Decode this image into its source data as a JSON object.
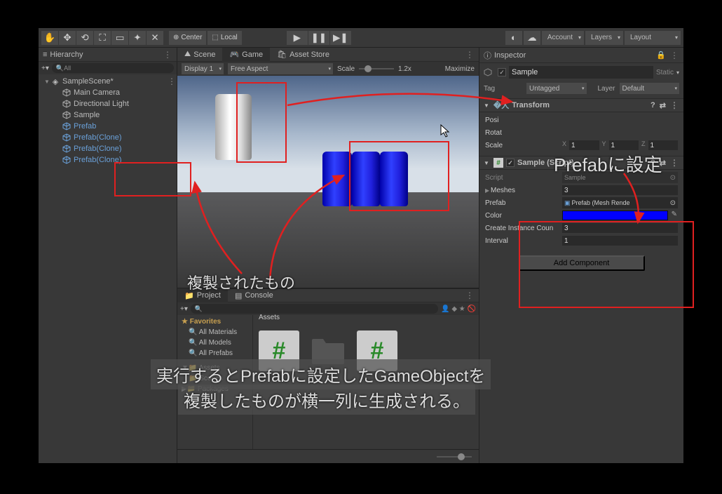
{
  "toolbar": {
    "center_label": "Center",
    "local_label": "Local",
    "account_label": "Account",
    "layers_label": "Layers",
    "layout_label": "Layout"
  },
  "hierarchy": {
    "title": "Hierarchy",
    "search_placeholder": "All",
    "scene": "SampleScene*",
    "items": [
      {
        "label": "Main Camera",
        "prefab": false
      },
      {
        "label": "Directional Light",
        "prefab": false
      },
      {
        "label": "Sample",
        "prefab": false
      },
      {
        "label": "Prefab",
        "prefab": true
      },
      {
        "label": "Prefab(Clone)",
        "prefab": true,
        "boxed": true
      },
      {
        "label": "Prefab(Clone)",
        "prefab": true,
        "boxed": true
      },
      {
        "label": "Prefab(Clone)",
        "prefab": true,
        "boxed": true
      }
    ]
  },
  "tabs": {
    "scene": "Scene",
    "game": "Game",
    "asset_store": "Asset Store"
  },
  "game_toolbar": {
    "display": "Display 1",
    "aspect": "Free Aspect",
    "scale_label": "Scale",
    "scale_value": "1.2x",
    "maximize": "Maximize"
  },
  "project": {
    "project_tab": "Project",
    "console_tab": "Console",
    "favorites": "Favorites",
    "fav_items": [
      "All Materials",
      "All Models",
      "All Prefabs"
    ],
    "assets_head": "Assets",
    "assets_items": [
      "Scenes"
    ],
    "packages": "Packages",
    "assets_breadcrumb": "Assets"
  },
  "inspector": {
    "title": "Inspector",
    "go_name": "Sample",
    "static_label": "Static",
    "tag_label": "Tag",
    "tag_value": "Untagged",
    "layer_label": "Layer",
    "layer_value": "Default",
    "transform": {
      "title": "Transform",
      "position": {
        "label": "Posi",
        "x": "",
        "y": "",
        "z": ""
      },
      "rotation": {
        "label": "Rotat",
        "x": "",
        "y": "",
        "z": ""
      },
      "scale": {
        "label": "Scale",
        "x": "1",
        "y": "1",
        "z": "1"
      }
    },
    "script": {
      "title": "Sample (Script)",
      "script_label": "Script",
      "script_value": "Sample",
      "meshes_label": "Meshes",
      "meshes_value": "3",
      "prefab_label": "Prefab",
      "prefab_value": "Prefab (Mesh Rende",
      "color_label": "Color",
      "count_label": "Create Instance Coun",
      "count_value": "3",
      "interval_label": "Interval",
      "interval_value": "1"
    },
    "add_component": "Add Component"
  },
  "annotations": {
    "cloned": "複製されたもの",
    "prefab_set": "Prefabに設定",
    "runtime1": "実行するとPrefabに設定したGameObjectを",
    "runtime2": "複製したものが横一列に生成される。"
  }
}
